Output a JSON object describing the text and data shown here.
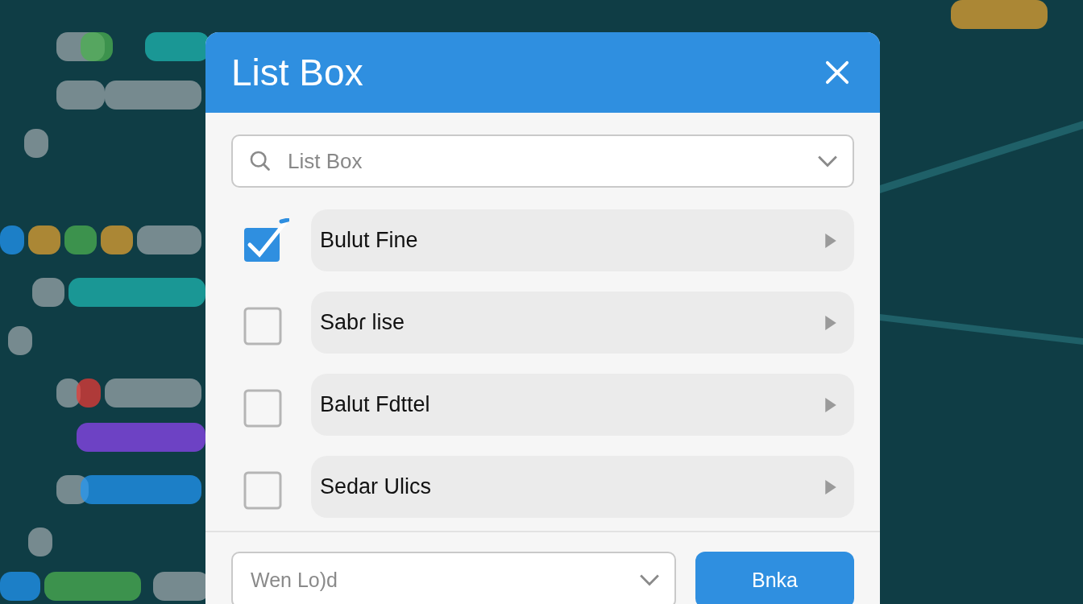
{
  "dialog": {
    "title": "List Box",
    "search": {
      "placeholder": "List Box"
    },
    "items": [
      {
        "label": "Bulut Fine",
        "checked": true
      },
      {
        "label": "Sabɾ lise",
        "checked": false
      },
      {
        "label": "Balut Fdttel",
        "checked": false
      },
      {
        "label": "Sedar Ulics",
        "checked": false
      }
    ],
    "footer": {
      "dropdown": {
        "placeholder": "Wen Lo)d"
      },
      "button": "Bnka"
    }
  }
}
